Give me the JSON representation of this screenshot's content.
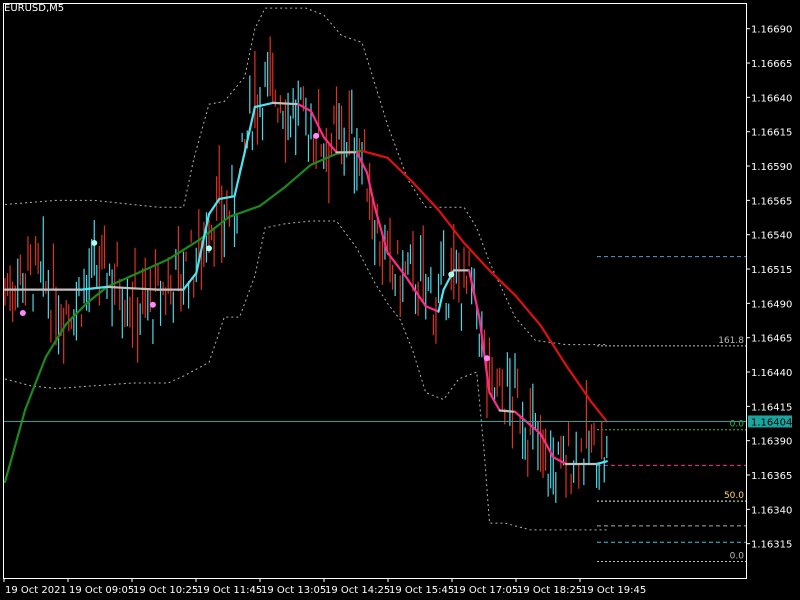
{
  "title": "EURUSD,M5",
  "current_price": "1.16404",
  "chart_data": {
    "type": "line",
    "symbol": "EURUSD",
    "timeframe": "M5",
    "ylim": [
      1.1629,
      1.16708
    ],
    "price_ticks": [
      "1.16690",
      "1.16665",
      "1.16640",
      "1.16615",
      "1.16590",
      "1.16565",
      "1.16540",
      "1.16515",
      "1.16490",
      "1.16465",
      "1.16440",
      "1.16415",
      "1.16390",
      "1.16365",
      "1.16340",
      "1.16315"
    ],
    "time_ticks": [
      "19 Oct 2021",
      "19 Oct 09:05",
      "19 Oct 10:25",
      "19 Oct 11:45",
      "19 Oct 13:05",
      "19 Oct 14:25",
      "19 Oct 15:45",
      "19 Oct 17:05",
      "19 Oct 18:25",
      "19 Oct 19:45"
    ],
    "colors": {
      "background": "#000000",
      "bull_bar": "#4dd8e8",
      "bear_bar": "#e03020",
      "smooth_up": "#4de4f0",
      "smooth_down": "#ff2b8a",
      "smooth_flat": "#c0c0c0",
      "long_ma_up": "#1b8a1b",
      "long_ma_down": "#e01010",
      "long_ma_flat": "#b0b0b0",
      "channel": "#b0b0b0",
      "current_price_line": "#1aa6a0",
      "fib": "#2aa198",
      "fib_label": "#ffd966"
    },
    "fib_levels": [
      {
        "label": "161.8",
        "price": 1.16459,
        "color": "#bbbbbb"
      },
      {
        "label": "0.0",
        "price": 1.16398,
        "color": "#3fbf3f"
      },
      {
        "label": "50.0",
        "price": 1.16346,
        "color": "#ccffcc"
      },
      {
        "label": "0.0",
        "price": 1.16302,
        "color": "#bbbbbb"
      }
    ],
    "extra_levels": [
      {
        "price": 1.16524,
        "color": "#4aa0d8"
      },
      {
        "price": 1.16372,
        "color": "#ff2b8a"
      },
      {
        "price": 1.16328,
        "color": "#aaaaaa"
      },
      {
        "price": 1.16316,
        "color": "#33ccdd"
      }
    ],
    "smooth_ma": [
      {
        "x": 0,
        "y": 1.165
      },
      {
        "x": 20,
        "y": 1.165
      },
      {
        "x": 30,
        "y": 1.165
      },
      {
        "x": 40,
        "y": 1.16502
      },
      {
        "x": 50,
        "y": 1.16501
      },
      {
        "x": 60,
        "y": 1.165
      },
      {
        "x": 70,
        "y": 1.165
      },
      {
        "x": 75,
        "y": 1.16512
      },
      {
        "x": 80,
        "y": 1.16555
      },
      {
        "x": 84,
        "y": 1.16566
      },
      {
        "x": 90,
        "y": 1.16568
      },
      {
        "x": 94,
        "y": 1.166
      },
      {
        "x": 98,
        "y": 1.16633
      },
      {
        "x": 105,
        "y": 1.16636
      },
      {
        "x": 115,
        "y": 1.16635
      },
      {
        "x": 120,
        "y": 1.1663
      },
      {
        "x": 125,
        "y": 1.16611
      },
      {
        "x": 130,
        "y": 1.166
      },
      {
        "x": 138,
        "y": 1.166
      },
      {
        "x": 142,
        "y": 1.16585
      },
      {
        "x": 145,
        "y": 1.1656
      },
      {
        "x": 150,
        "y": 1.16527
      },
      {
        "x": 157,
        "y": 1.1651
      },
      {
        "x": 165,
        "y": 1.16488
      },
      {
        "x": 170,
        "y": 1.16484
      },
      {
        "x": 172,
        "y": 1.165
      },
      {
        "x": 176,
        "y": 1.16514
      },
      {
        "x": 182,
        "y": 1.16514
      },
      {
        "x": 186,
        "y": 1.1648
      },
      {
        "x": 190,
        "y": 1.16425
      },
      {
        "x": 194,
        "y": 1.16412
      },
      {
        "x": 200,
        "y": 1.16411
      },
      {
        "x": 210,
        "y": 1.16395
      },
      {
        "x": 215,
        "y": 1.16378
      },
      {
        "x": 220,
        "y": 1.16373
      },
      {
        "x": 232,
        "y": 1.16373
      },
      {
        "x": 236,
        "y": 1.16375
      }
    ],
    "long_ma": [
      {
        "x": 0,
        "y": 1.1636
      },
      {
        "x": 8,
        "y": 1.16413
      },
      {
        "x": 16,
        "y": 1.16451
      },
      {
        "x": 24,
        "y": 1.16475
      },
      {
        "x": 32,
        "y": 1.1649
      },
      {
        "x": 40,
        "y": 1.16502
      },
      {
        "x": 52,
        "y": 1.16512
      },
      {
        "x": 64,
        "y": 1.16522
      },
      {
        "x": 76,
        "y": 1.16536
      },
      {
        "x": 88,
        "y": 1.16553
      },
      {
        "x": 100,
        "y": 1.16561
      },
      {
        "x": 110,
        "y": 1.16575
      },
      {
        "x": 120,
        "y": 1.16591
      },
      {
        "x": 130,
        "y": 1.16599
      },
      {
        "x": 140,
        "y": 1.16601
      },
      {
        "x": 150,
        "y": 1.16596
      },
      {
        "x": 160,
        "y": 1.16578
      },
      {
        "x": 170,
        "y": 1.16558
      },
      {
        "x": 180,
        "y": 1.16534
      },
      {
        "x": 190,
        "y": 1.16514
      },
      {
        "x": 200,
        "y": 1.16496
      },
      {
        "x": 210,
        "y": 1.16474
      },
      {
        "x": 220,
        "y": 1.16445
      },
      {
        "x": 230,
        "y": 1.16418
      },
      {
        "x": 236,
        "y": 1.16404
      }
    ],
    "upper_channel": [
      {
        "x": 0,
        "y": 1.16562
      },
      {
        "x": 20,
        "y": 1.16565
      },
      {
        "x": 35,
        "y": 1.16565
      },
      {
        "x": 50,
        "y": 1.16562
      },
      {
        "x": 60,
        "y": 1.1656
      },
      {
        "x": 70,
        "y": 1.1656
      },
      {
        "x": 74,
        "y": 1.16595
      },
      {
        "x": 80,
        "y": 1.16635
      },
      {
        "x": 86,
        "y": 1.16637
      },
      {
        "x": 94,
        "y": 1.16655
      },
      {
        "x": 98,
        "y": 1.1669
      },
      {
        "x": 102,
        "y": 1.16705
      },
      {
        "x": 110,
        "y": 1.16705
      },
      {
        "x": 118,
        "y": 1.16705
      },
      {
        "x": 125,
        "y": 1.167
      },
      {
        "x": 132,
        "y": 1.16685
      },
      {
        "x": 140,
        "y": 1.1668
      },
      {
        "x": 145,
        "y": 1.1665
      },
      {
        "x": 150,
        "y": 1.1662
      },
      {
        "x": 158,
        "y": 1.1658
      },
      {
        "x": 165,
        "y": 1.1656
      },
      {
        "x": 175,
        "y": 1.1656
      },
      {
        "x": 180,
        "y": 1.1656
      },
      {
        "x": 185,
        "y": 1.16545
      },
      {
        "x": 190,
        "y": 1.1652
      },
      {
        "x": 195,
        "y": 1.165
      },
      {
        "x": 200,
        "y": 1.1648
      },
      {
        "x": 208,
        "y": 1.16463
      },
      {
        "x": 220,
        "y": 1.1646
      },
      {
        "x": 236,
        "y": 1.1646
      }
    ],
    "lower_channel": [
      {
        "x": 0,
        "y": 1.16435
      },
      {
        "x": 10,
        "y": 1.1643
      },
      {
        "x": 20,
        "y": 1.16428
      },
      {
        "x": 35,
        "y": 1.1643
      },
      {
        "x": 50,
        "y": 1.16432
      },
      {
        "x": 64,
        "y": 1.16432
      },
      {
        "x": 70,
        "y": 1.16437
      },
      {
        "x": 80,
        "y": 1.16447
      },
      {
        "x": 86,
        "y": 1.1648
      },
      {
        "x": 92,
        "y": 1.1648
      },
      {
        "x": 98,
        "y": 1.1651
      },
      {
        "x": 102,
        "y": 1.16545
      },
      {
        "x": 110,
        "y": 1.16548
      },
      {
        "x": 120,
        "y": 1.1655
      },
      {
        "x": 130,
        "y": 1.1655
      },
      {
        "x": 138,
        "y": 1.1653
      },
      {
        "x": 145,
        "y": 1.16505
      },
      {
        "x": 150,
        "y": 1.1649
      },
      {
        "x": 155,
        "y": 1.16478
      },
      {
        "x": 160,
        "y": 1.16455
      },
      {
        "x": 165,
        "y": 1.16425
      },
      {
        "x": 172,
        "y": 1.1642
      },
      {
        "x": 178,
        "y": 1.16435
      },
      {
        "x": 185,
        "y": 1.1644
      },
      {
        "x": 188,
        "y": 1.1638
      },
      {
        "x": 190,
        "y": 1.1633
      },
      {
        "x": 196,
        "y": 1.1633
      },
      {
        "x": 206,
        "y": 1.16325
      },
      {
        "x": 215,
        "y": 1.16325
      },
      {
        "x": 224,
        "y": 1.16325
      },
      {
        "x": 236,
        "y": 1.16325
      }
    ],
    "signal_dots": [
      {
        "x": 7,
        "y": 1.16483,
        "color": "#ff88ff"
      },
      {
        "x": 35,
        "y": 1.16534,
        "color": "#aaffee"
      },
      {
        "x": 58,
        "y": 1.16489,
        "color": "#ff88ff"
      },
      {
        "x": 80,
        "y": 1.1653,
        "color": "#aaffee"
      },
      {
        "x": 122,
        "y": 1.16612,
        "color": "#ff88ff"
      },
      {
        "x": 175,
        "y": 1.16511,
        "color": "#aaffee"
      },
      {
        "x": 189,
        "y": 1.1645,
        "color": "#ff88ff"
      }
    ]
  }
}
